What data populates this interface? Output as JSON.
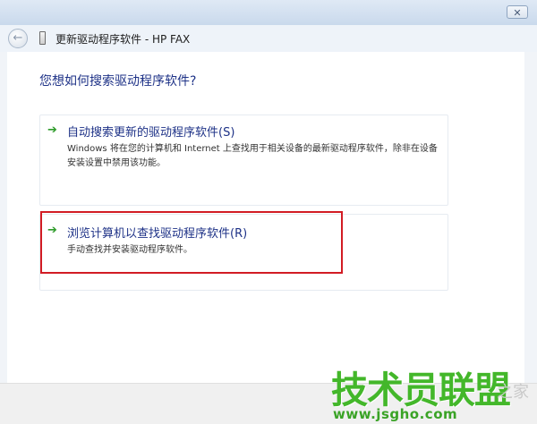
{
  "window": {
    "title": "更新驱动程序软件 - HP FAX",
    "close_glyph": "✕"
  },
  "nav": {
    "back_glyph": "←"
  },
  "question": "您想如何搜索驱动程序软件?",
  "options": [
    {
      "title": "自动搜索更新的驱动程序软件(S)",
      "description": "Windows 将在您的计算机和 Internet 上查找用于相关设备的最新驱动程序软件，除非在设备安装设置中禁用该功能。"
    },
    {
      "title": "浏览计算机以查找驱动程序软件(R)",
      "description": "手动查找并安装驱动程序软件。",
      "highlighted": true
    }
  ],
  "arrow_glyph": "➔",
  "watermark": {
    "main": "技术员联盟",
    "url": "www.jsgho.com",
    "ghost": "之家"
  },
  "colors": {
    "link_blue": "#1e3287",
    "arrow_green": "#2e9b2a",
    "highlight_red": "#d21c24",
    "watermark_green": "#43b72a"
  }
}
